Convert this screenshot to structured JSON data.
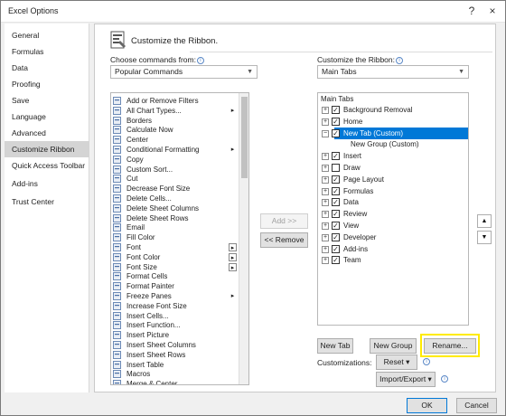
{
  "window": {
    "title": "Excel Options",
    "help_icon": "?",
    "close_icon": "×"
  },
  "nav": {
    "items": [
      "General",
      "Formulas",
      "Data",
      "Proofing",
      "Save",
      "Language",
      "Advanced",
      "Customize Ribbon",
      "Quick Access Toolbar",
      "Add-ins",
      "Trust Center"
    ],
    "active_index": 7
  },
  "header": {
    "title": "Customize the Ribbon."
  },
  "left": {
    "label": "Choose commands from:",
    "dropdown_value": "Popular Commands",
    "commands": [
      {
        "label": "Add or Remove Filters",
        "icon": "filter-icon"
      },
      {
        "label": "All Chart Types...",
        "icon": "chart-icon"
      },
      {
        "label": "Borders",
        "icon": "borders-icon"
      },
      {
        "label": "Calculate Now",
        "icon": "calculator-icon"
      },
      {
        "label": "Center",
        "icon": "center-icon"
      },
      {
        "label": "Conditional Formatting",
        "icon": "conditional-formatting-icon"
      },
      {
        "label": "Copy",
        "icon": "copy-icon"
      },
      {
        "label": "Custom Sort...",
        "icon": "sort-icon"
      },
      {
        "label": "Cut",
        "icon": "scissors-icon"
      },
      {
        "label": "Decrease Font Size",
        "icon": "decrease-font-icon"
      },
      {
        "label": "Delete Cells...",
        "icon": "delete-cells-icon"
      },
      {
        "label": "Delete Sheet Columns",
        "icon": "delete-columns-icon"
      },
      {
        "label": "Delete Sheet Rows",
        "icon": "delete-rows-icon"
      },
      {
        "label": "Email",
        "icon": "email-icon"
      },
      {
        "label": "Fill Color",
        "icon": "fill-color-icon"
      },
      {
        "label": "Font",
        "icon": "font-icon"
      },
      {
        "label": "Font Color",
        "icon": "font-color-icon"
      },
      {
        "label": "Font Size",
        "icon": "font-size-icon"
      },
      {
        "label": "Format Cells",
        "icon": "format-cells-icon"
      },
      {
        "label": "Format Painter",
        "icon": "format-painter-icon"
      },
      {
        "label": "Freeze Panes",
        "icon": "freeze-panes-icon"
      },
      {
        "label": "Increase Font Size",
        "icon": "increase-font-icon"
      },
      {
        "label": "Insert Cells...",
        "icon": "insert-cells-icon"
      },
      {
        "label": "Insert Function...",
        "icon": "function-icon"
      },
      {
        "label": "Insert Picture",
        "icon": "picture-icon"
      },
      {
        "label": "Insert Sheet Columns",
        "icon": "insert-columns-icon"
      },
      {
        "label": "Insert Sheet Rows",
        "icon": "insert-rows-icon"
      },
      {
        "label": "Insert Table",
        "icon": "table-icon"
      },
      {
        "label": "Macros",
        "icon": "macros-icon"
      },
      {
        "label": "Merge & Center",
        "icon": "merge-icon"
      }
    ],
    "submenu_rows": [
      1,
      5,
      20
    ],
    "stepper_rows": [
      15,
      16,
      17
    ]
  },
  "middle": {
    "add_label": "Add >>",
    "remove_label": "<< Remove"
  },
  "right": {
    "label": "Customize the Ribbon:",
    "dropdown_value": "Main Tabs",
    "tree_header": "Main Tabs",
    "tree": [
      {
        "label": "Background Removal",
        "checked": true,
        "expander": "+"
      },
      {
        "label": "Home",
        "checked": true,
        "expander": "+"
      },
      {
        "label": "New Tab (Custom)",
        "checked": true,
        "expander": "−",
        "selected": true
      },
      {
        "label": "New Group (Custom)",
        "child": true
      },
      {
        "label": "Insert",
        "checked": true,
        "expander": "+"
      },
      {
        "label": "Draw",
        "checked": false,
        "expander": "+"
      },
      {
        "label": "Page Layout",
        "checked": true,
        "expander": "+"
      },
      {
        "label": "Formulas",
        "checked": true,
        "expander": "+"
      },
      {
        "label": "Data",
        "checked": true,
        "expander": "+"
      },
      {
        "label": "Review",
        "checked": true,
        "expander": "+"
      },
      {
        "label": "View",
        "checked": true,
        "expander": "+"
      },
      {
        "label": "Developer",
        "checked": true,
        "expander": "+"
      },
      {
        "label": "Add-ins",
        "checked": true,
        "expander": "+"
      },
      {
        "label": "Team",
        "checked": true,
        "expander": "+"
      }
    ],
    "new_tab_label": "New Tab",
    "new_group_label": "New Group",
    "rename_label": "Rename...",
    "customizations_label": "Customizations:",
    "reset_label": "Reset ▾",
    "import_export_label": "Import/Export ▾",
    "move_up": "▲",
    "move_down": "▼"
  },
  "footer": {
    "ok_label": "OK",
    "cancel_label": "Cancel"
  },
  "colors": {
    "selection": "#0078d7",
    "highlight": "#ffeb00",
    "active_nav": "#d4d4d4"
  }
}
